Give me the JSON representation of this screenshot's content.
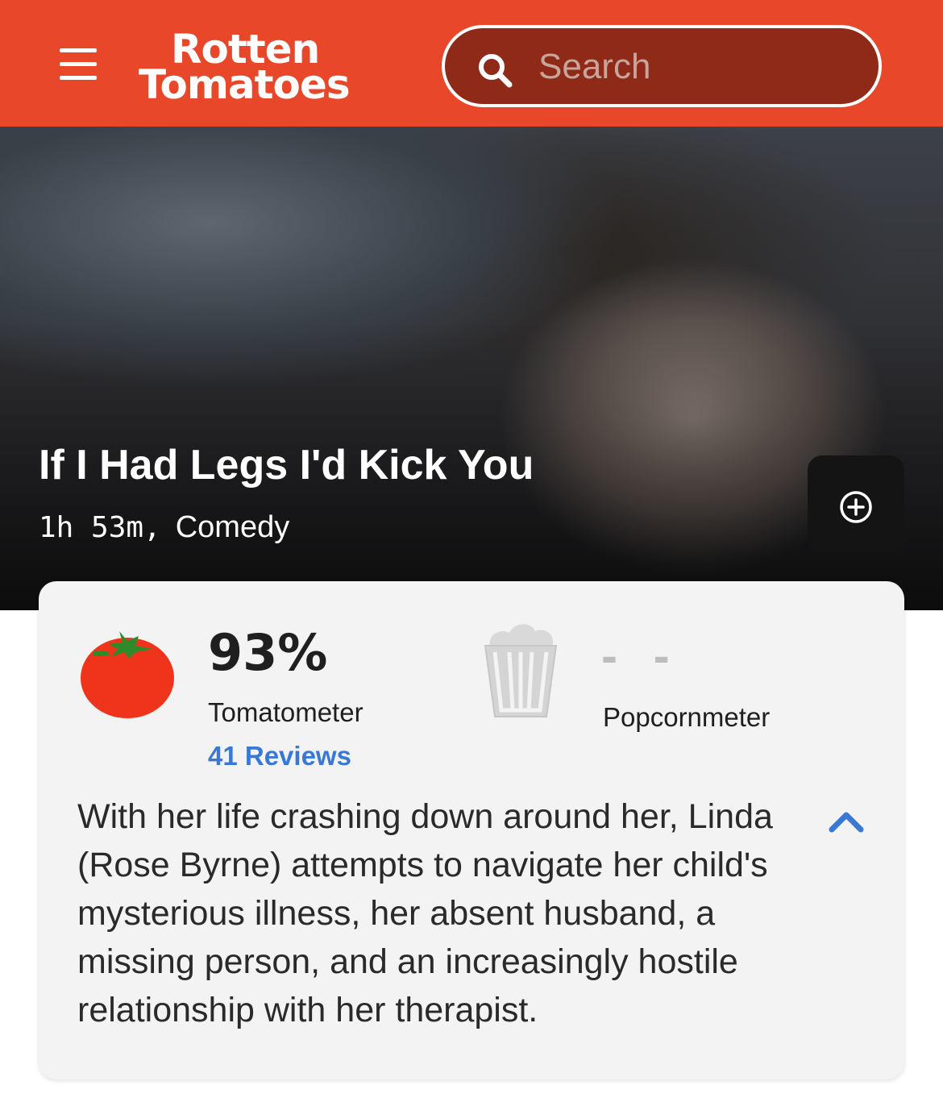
{
  "header": {
    "logo_line1": "Rotten",
    "logo_line2": "Tomatoes",
    "menu_icon": "hamburger-menu-icon",
    "search": {
      "placeholder": "Search",
      "icon": "search-icon"
    }
  },
  "movie": {
    "title": "If I Had Legs I'd Kick You",
    "runtime": "1h 53m,",
    "genre": "Comedy",
    "add_icon": "plus-circle-icon"
  },
  "scores": {
    "tomatometer": {
      "value": "93%",
      "label": "Tomatometer",
      "reviews": "41 Reviews",
      "icon": "tomato-icon"
    },
    "popcornmeter": {
      "value": "- -",
      "label": "Popcornmeter",
      "icon": "popcorn-bucket-icon"
    }
  },
  "synopsis": {
    "text": "With her life crashing down around her, Linda (Rose Byrne) attempts to navigate her child's mysterious illness, her absent husband, a missing person, and an increasingly hostile relationship with her therapist.",
    "toggle_icon": "chevron-up-icon"
  },
  "colors": {
    "brand_red": "#e8472a",
    "search_bg": "#8e2a17",
    "link_blue": "#3a78d6"
  }
}
